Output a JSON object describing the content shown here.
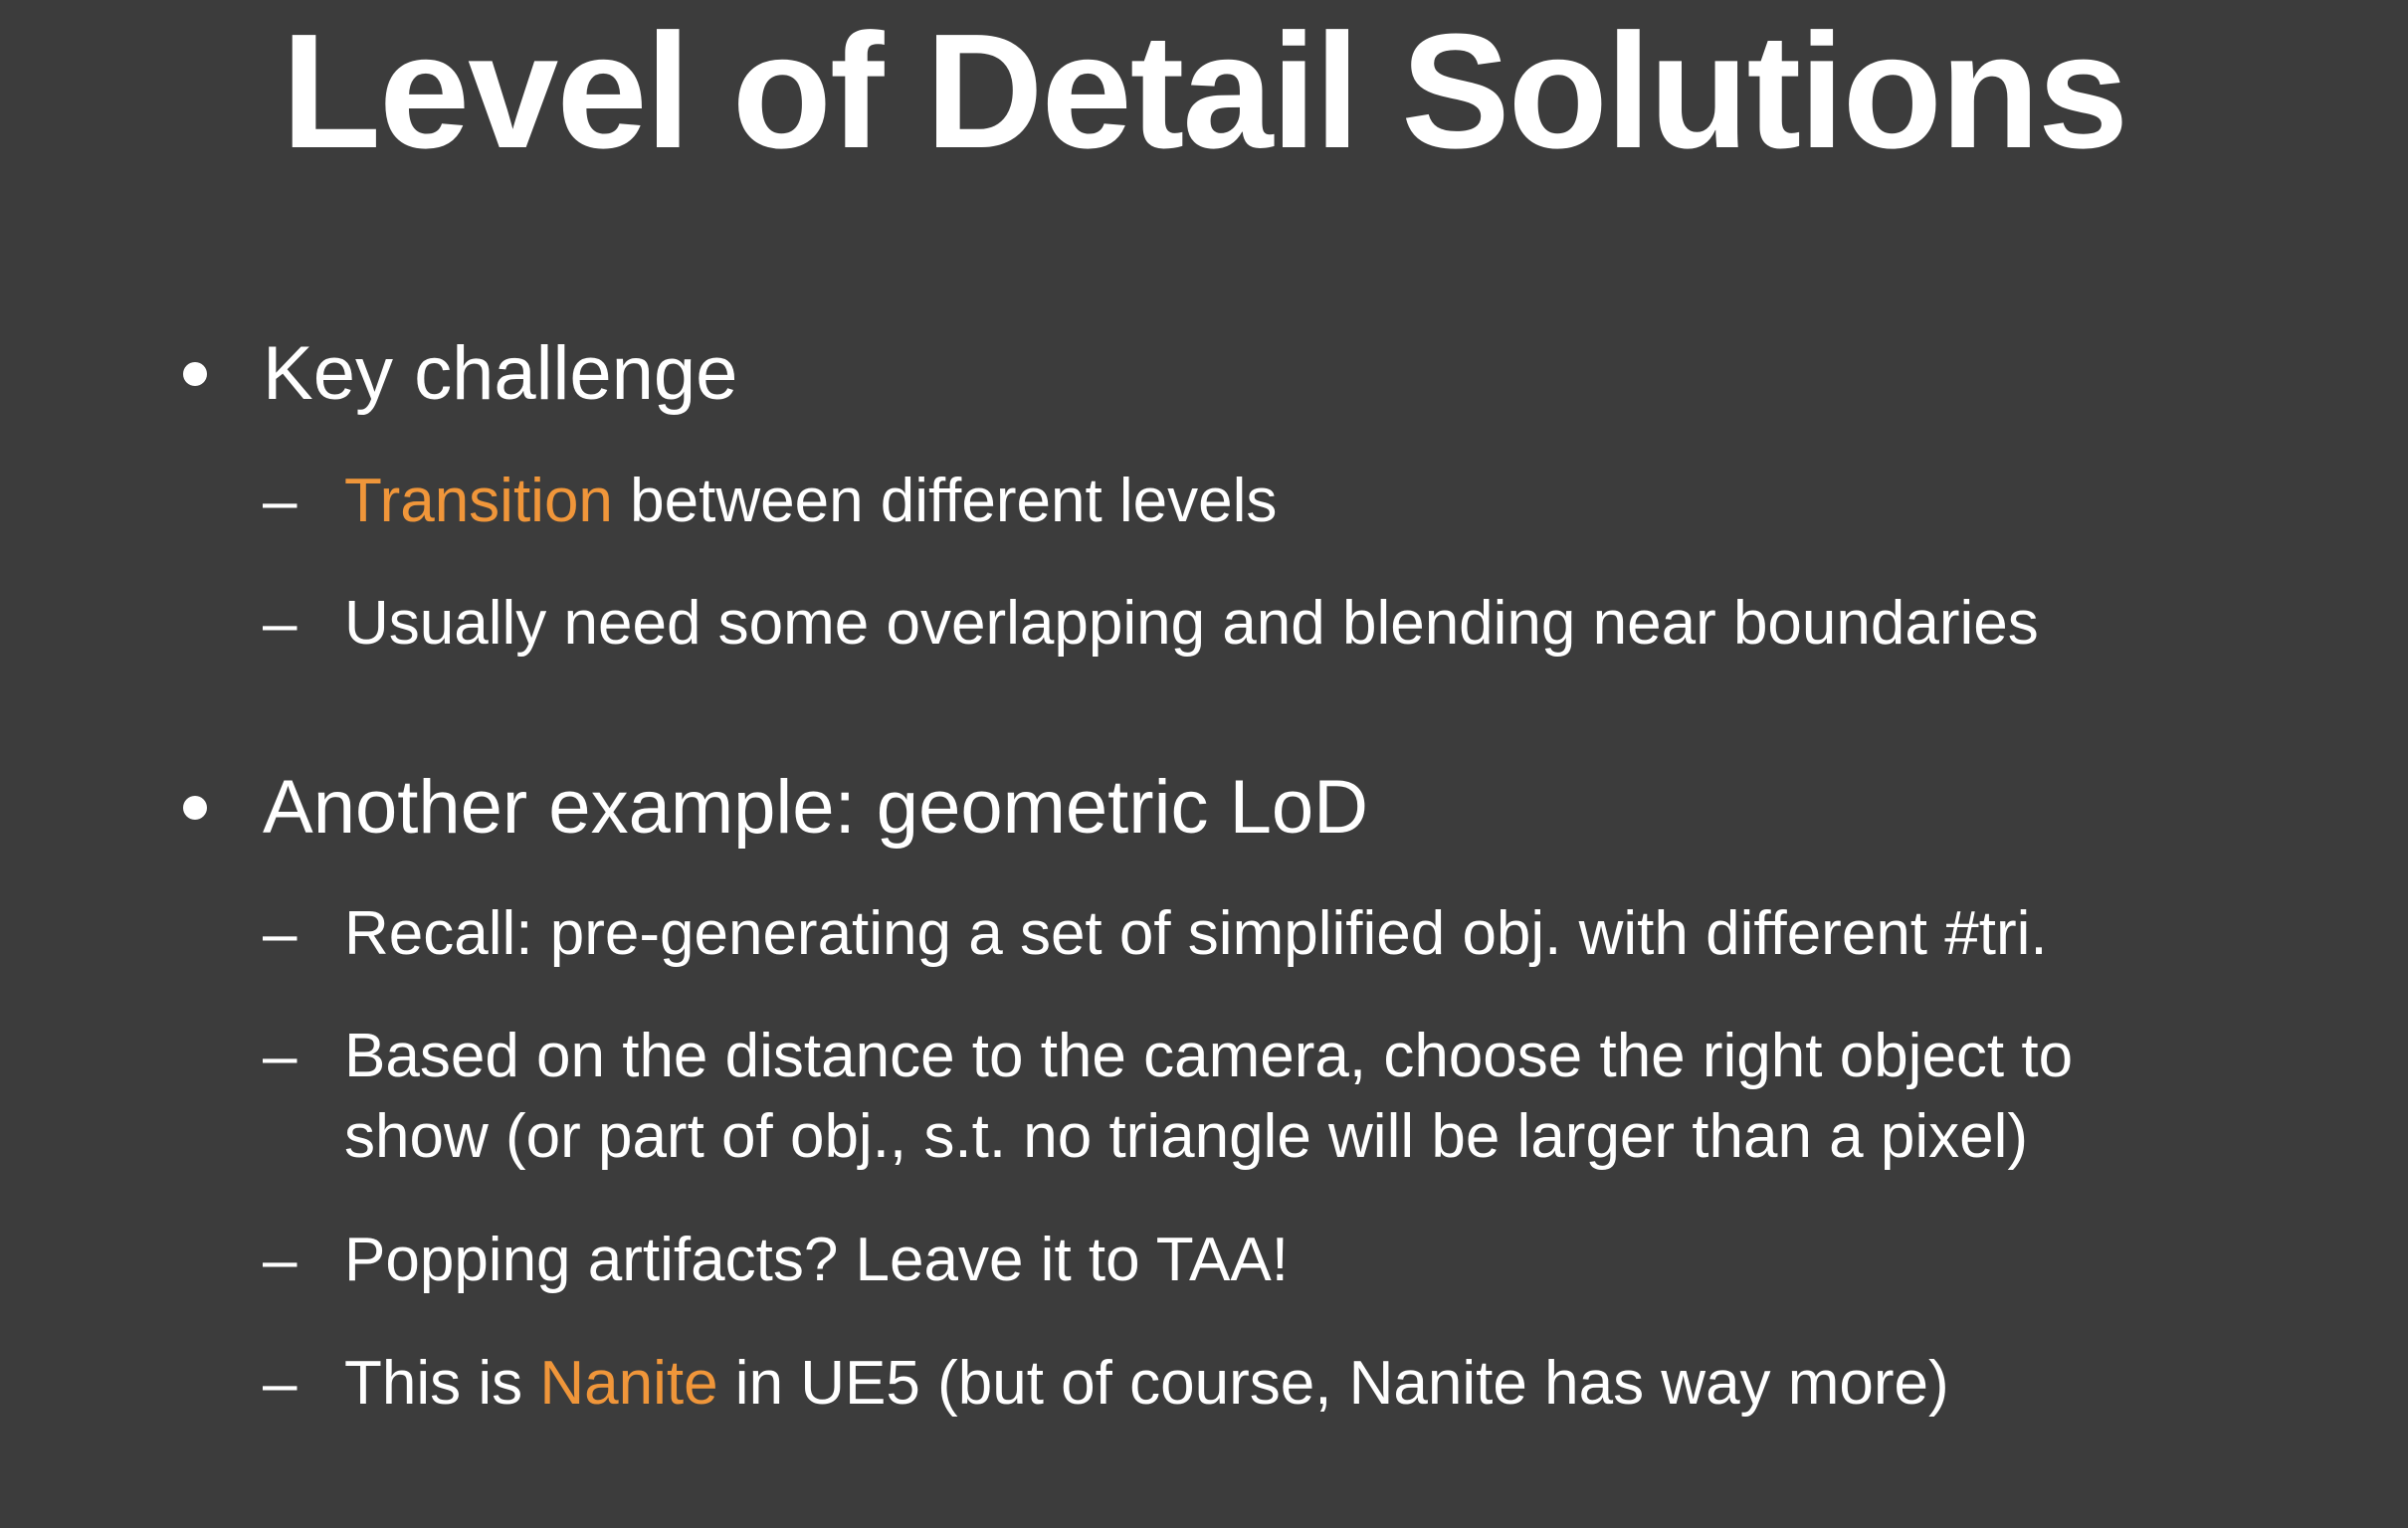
{
  "slide": {
    "title": "Level of Detail Solutions",
    "accent_color": "#f0963a",
    "background_color": "#3c3c3c",
    "bullets": [
      {
        "text": "Key challenge",
        "subs": [
          {
            "highlight": "Transition",
            "rest": " between different levels"
          },
          {
            "text": "Usually need some overlapping and blending near boundaries"
          }
        ]
      },
      {
        "text": "Another example: geometric LoD",
        "subs": [
          {
            "text": "Recall: pre-generating a set of simplified obj. with different #tri."
          },
          {
            "line1": "Based on the distance to the camera, choose the right object to",
            "line2": "show (or part of obj., s.t. no triangle will be larger than a pixel)"
          },
          {
            "text": "Popping artifacts? Leave it to TAA!"
          },
          {
            "before": "This is ",
            "highlight": "Nanite",
            "after": " in UE5 (but of course, Nanite has way more)"
          }
        ]
      }
    ],
    "dash": "–"
  }
}
